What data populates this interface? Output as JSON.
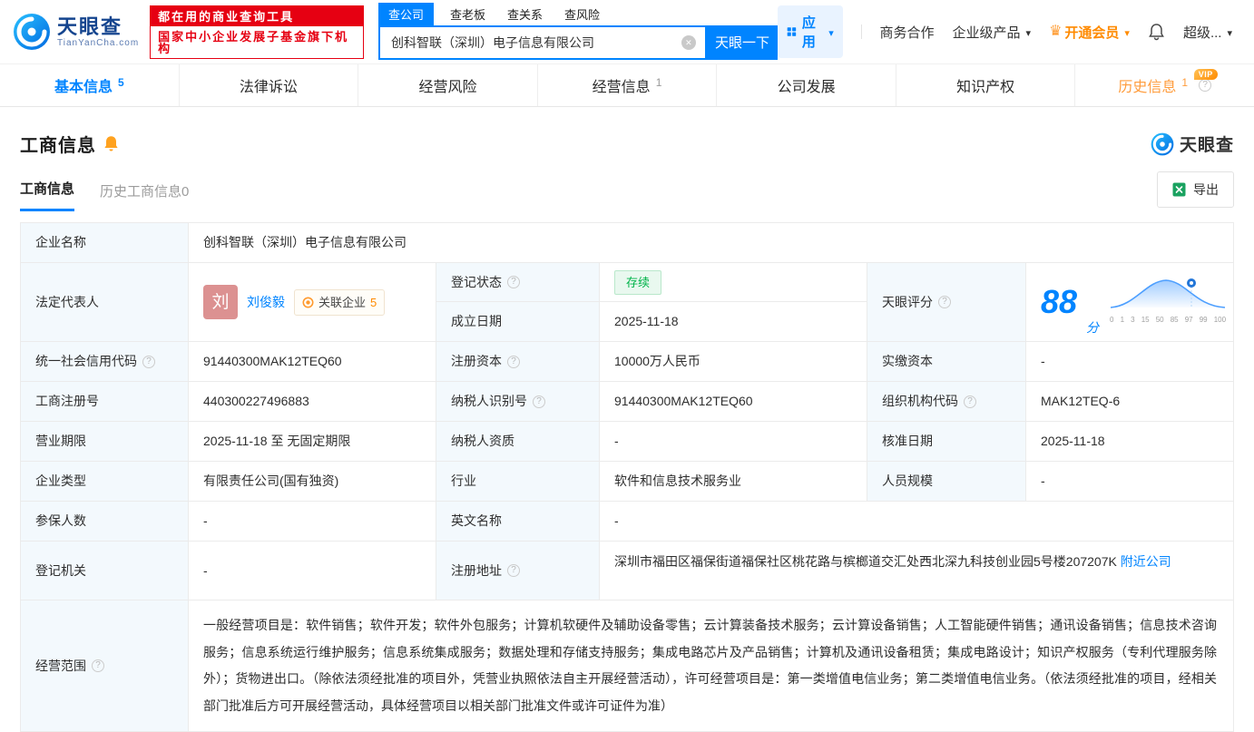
{
  "header": {
    "logo": {
      "brand": "天眼查",
      "domain": "TianYanCha.com"
    },
    "slogan": {
      "line1": "都在用的商业查询工具",
      "line2": "国家中小企业发展子基金旗下机构"
    },
    "search": {
      "tabs": [
        {
          "label": "查公司"
        },
        {
          "label": "查老板"
        },
        {
          "label": "查关系"
        },
        {
          "label": "查风险"
        }
      ],
      "value": "创科智联（深圳）电子信息有限公司",
      "button": "天眼一下"
    },
    "menu": {
      "apps": "应用",
      "cooperation": "商务合作",
      "enterprise": "企业级产品",
      "vip": "开通会员",
      "super": "超级..."
    }
  },
  "nav": {
    "tabs": [
      {
        "label": "基本信息",
        "count": "5"
      },
      {
        "label": "法律诉讼"
      },
      {
        "label": "经营风险"
      },
      {
        "label": "经营信息",
        "count": "1"
      },
      {
        "label": "公司发展"
      },
      {
        "label": "知识产权"
      },
      {
        "label": "历史信息",
        "count": "1",
        "vip": "VIP"
      }
    ]
  },
  "section": {
    "title": "工商信息",
    "watermark": "天眼查",
    "subtabs": [
      {
        "label": "工商信息"
      },
      {
        "label": "历史工商信息0"
      }
    ],
    "export_label": "导出"
  },
  "table": {
    "company_name": {
      "label": "企业名称",
      "value": "创科智联（深圳）电子信息有限公司"
    },
    "legal_rep": {
      "label": "法定代表人",
      "avatar": "刘",
      "name": "刘俊毅",
      "related_label": "关联企业",
      "related_count": "5"
    },
    "reg_status": {
      "label": "登记状态",
      "value": "存续"
    },
    "establish_date": {
      "label": "成立日期",
      "value": "2025-11-18"
    },
    "score": {
      "label": "天眼评分",
      "value": "88",
      "unit": "分",
      "axis": [
        "0",
        "1",
        "3",
        "15",
        "50",
        "85",
        "97",
        "99",
        "100"
      ]
    },
    "credit_code": {
      "label": "统一社会信用代码",
      "value": "91440300MAK12TEQ60"
    },
    "reg_capital": {
      "label": "注册资本",
      "value": "10000万人民币"
    },
    "paid_capital": {
      "label": "实缴资本",
      "value": "-"
    },
    "reg_number": {
      "label": "工商注册号",
      "value": "440300227496883"
    },
    "taxpayer_id": {
      "label": "纳税人识别号",
      "value": "91440300MAK12TEQ60"
    },
    "org_code": {
      "label": "组织机构代码",
      "value": "MAK12TEQ-6"
    },
    "business_term": {
      "label": "营业期限",
      "value": "2025-11-18 至 无固定期限"
    },
    "taxpayer_qualification": {
      "label": "纳税人资质",
      "value": "-"
    },
    "approval_date": {
      "label": "核准日期",
      "value": "2025-11-18"
    },
    "company_type": {
      "label": "企业类型",
      "value": "有限责任公司(国有独资)"
    },
    "industry": {
      "label": "行业",
      "value": "软件和信息技术服务业"
    },
    "staff_size": {
      "label": "人员规模",
      "value": "-"
    },
    "insured_count": {
      "label": "参保人数",
      "value": "-"
    },
    "english_name": {
      "label": "英文名称",
      "value": "-"
    },
    "reg_authority": {
      "label": "登记机关",
      "value": "-"
    },
    "reg_address": {
      "label": "注册地址",
      "value": "深圳市福田区福保街道福保社区桃花路与槟榔道交汇处西北深九科技创业园5号楼207207K ",
      "nearby": "附近公司"
    },
    "business_scope": {
      "label": "经营范围",
      "value": "一般经营项目是：软件销售；软件开发；软件外包服务；计算机软硬件及辅助设备零售；云计算装备技术服务；云计算设备销售；人工智能硬件销售；通讯设备销售；信息技术咨询服务；信息系统运行维护服务；信息系统集成服务；数据处理和存储支持服务；集成电路芯片及产品销售；计算机及通讯设备租赁；集成电路设计；知识产权服务（专利代理服务除外）；货物进出口。（除依法须经批准的项目外，凭营业执照依法自主开展经营活动），许可经营项目是：第一类增值电信业务；第二类增值电信业务。（依法须经批准的项目，经相关部门批准后方可开展经营活动，具体经营项目以相关部门批准文件或许可证件为准）"
    }
  },
  "colors": {
    "brand_blue": "#0084ff",
    "vip_orange": "#ff8a00",
    "status_green": "#00b34a",
    "badge_red": "#e60012"
  }
}
